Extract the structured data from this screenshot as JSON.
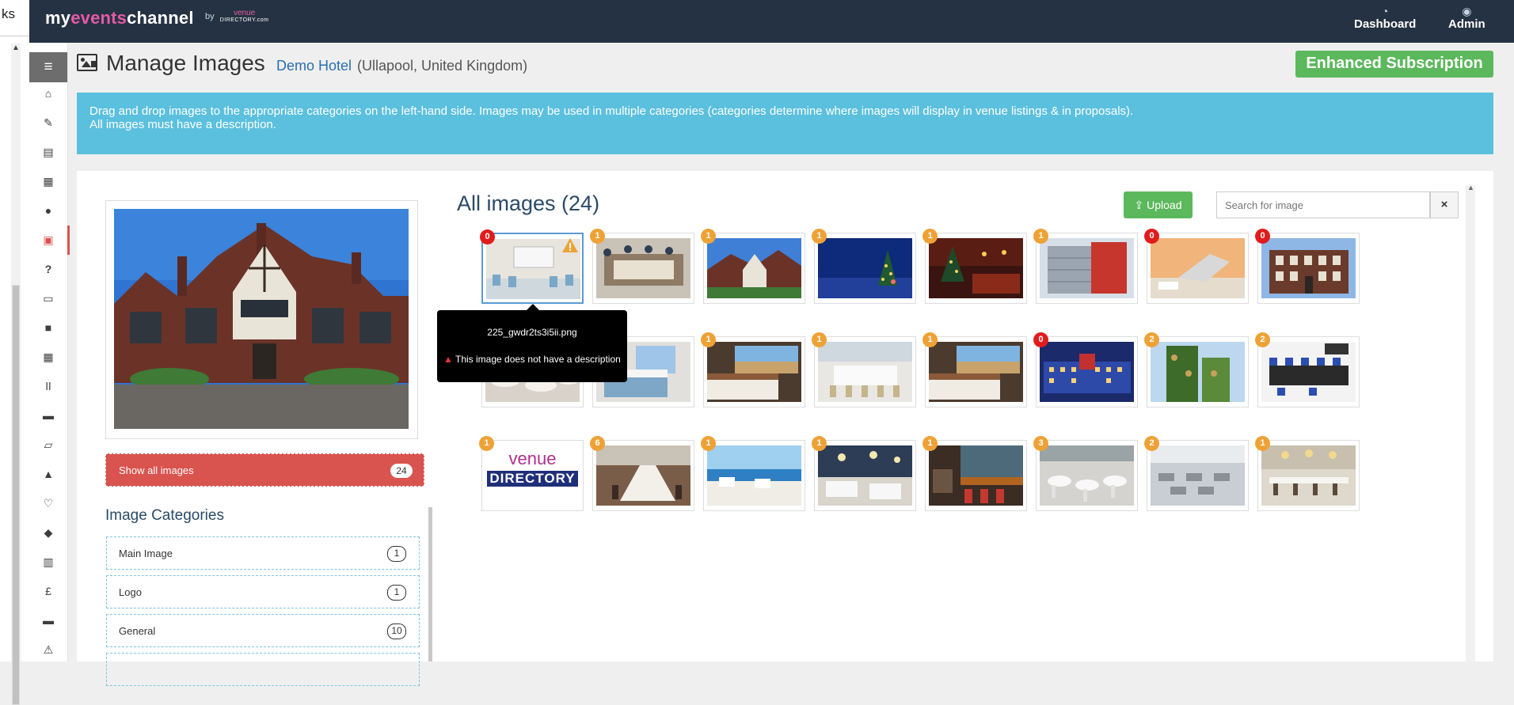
{
  "outer": {
    "fragment": "ks"
  },
  "nav": {
    "logo_prefix": "my",
    "logo_events": "events",
    "logo_suffix": "channel",
    "logo_by": "by",
    "logo_venue": "venue",
    "logo_directory": "DIRECTORY.com",
    "items": [
      {
        "label": "Dashboard",
        "icon": "dashboard-icon"
      },
      {
        "label": "Admin",
        "icon": "user-circle-icon"
      }
    ]
  },
  "sidebar": {
    "icons": [
      "home-icon",
      "edit-icon",
      "document-icon",
      "calendar-icon",
      "user-icon",
      "image-icon",
      "question-icon",
      "monitor-icon",
      "briefcase-icon",
      "calculator-icon",
      "cutlery-icon",
      "bed-icon",
      "book-icon",
      "tree-icon",
      "heart-icon",
      "tags-icon",
      "id-card-icon",
      "pound-icon",
      "credit-card-icon",
      "warning-icon"
    ],
    "active": "image-icon"
  },
  "header": {
    "title": "Manage Images",
    "venue_name": "Demo Hotel",
    "venue_location": "(Ullapool, United Kingdom)",
    "subscription": "Enhanced Subscription"
  },
  "info": {
    "line1": "Drag and drop images to the appropriate categories on the left-hand side. Images may be used in multiple categories (categories determine where images will display in venue listings & in proposals).",
    "line2": "All images must have a description."
  },
  "left": {
    "show_all_label": "Show all images",
    "show_all_count": "24",
    "categories_title": "Image Categories",
    "categories": [
      {
        "label": "Main Image",
        "count": "1"
      },
      {
        "label": "Logo",
        "count": "1"
      },
      {
        "label": "General",
        "count": "10"
      }
    ]
  },
  "gallery": {
    "title": "All images (24)",
    "upload_label": "Upload",
    "search_placeholder": "Search for image",
    "clear_label": "×",
    "thumbs": [
      {
        "count": "0",
        "color": "#e11c1c",
        "scene": "meeting-room",
        "warning": true
      },
      {
        "count": "1",
        "color": "#eea236",
        "scene": "conference"
      },
      {
        "count": "1",
        "color": "#eea236",
        "scene": "tudor-house"
      },
      {
        "count": "1",
        "color": "#eea236",
        "scene": "christmas-night"
      },
      {
        "count": "1",
        "color": "#eea236",
        "scene": "christmas-room"
      },
      {
        "count": "1",
        "color": "#eea236",
        "scene": "modern-building"
      },
      {
        "count": "0",
        "color": "#e11c1c",
        "scene": "laptop-desk"
      },
      {
        "count": "0",
        "color": "#e11c1c",
        "scene": "georgian-house"
      },
      {
        "count": "1",
        "color": "#eea236",
        "scene": "dining-room"
      },
      {
        "count": "1",
        "color": "#eea236",
        "scene": "bedroom-blue"
      },
      {
        "count": "1",
        "color": "#eea236",
        "scene": "bedroom-view"
      },
      {
        "count": "1",
        "color": "#eea236",
        "scene": "banquet"
      },
      {
        "count": "1",
        "color": "#eea236",
        "scene": "bedroom-view"
      },
      {
        "count": "0",
        "color": "#e11c1c",
        "scene": "hotel-night"
      },
      {
        "count": "2",
        "color": "#eea236",
        "scene": "green-tower"
      },
      {
        "count": "2",
        "color": "#eea236",
        "scene": "boardroom"
      },
      {
        "count": "1",
        "color": "#eea236",
        "scene": "venue-logo"
      },
      {
        "count": "6",
        "color": "#eea236",
        "scene": "long-table"
      },
      {
        "count": "1",
        "color": "#eea236",
        "scene": "sea-terrace"
      },
      {
        "count": "1",
        "color": "#eea236",
        "scene": "restaurant"
      },
      {
        "count": "1",
        "color": "#eea236",
        "scene": "bar"
      },
      {
        "count": "3",
        "color": "#eea236",
        "scene": "wedding-hall"
      },
      {
        "count": "2",
        "color": "#eea236",
        "scene": "ballroom"
      },
      {
        "count": "1",
        "color": "#eea236",
        "scene": "chandelier-hall"
      }
    ],
    "logo_top": "venue",
    "logo_bottom": "DIRECTORY"
  },
  "tooltip": {
    "filename": "225_gwdr2ts3i5ii.png",
    "message": "This image does not have a description"
  }
}
